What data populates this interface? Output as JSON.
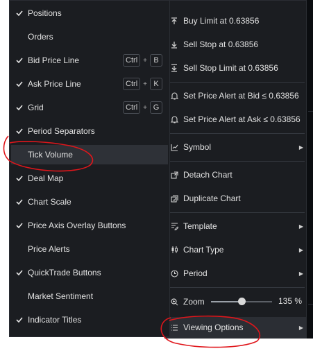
{
  "main_menu": {
    "items": [
      {
        "label": "Buy Limit at 0.63856",
        "icon": "arrow-up-to-line-icon",
        "submenu": false
      },
      {
        "label": "Sell Stop at 0.63856",
        "icon": "arrow-down-to-line-icon",
        "submenu": false
      },
      {
        "label": "Sell Stop Limit at 0.63856",
        "icon": "arrow-down-to-line-double-icon",
        "submenu": false
      },
      {
        "label": "Set Price Alert at Bid ≤ 0.63856",
        "icon": "bell-icon",
        "submenu": false
      },
      {
        "label": "Set Price Alert at Ask ≤ 0.63856",
        "icon": "bell-icon",
        "submenu": false
      },
      {
        "label": "Symbol",
        "icon": "chart-icon",
        "submenu": true
      },
      {
        "label": "Detach Chart",
        "icon": "detach-icon",
        "submenu": false
      },
      {
        "label": "Duplicate Chart",
        "icon": "duplicate-icon",
        "submenu": false
      },
      {
        "label": "Template",
        "icon": "template-icon",
        "submenu": true
      },
      {
        "label": "Chart Type",
        "icon": "candle-icon",
        "submenu": true
      },
      {
        "label": "Period",
        "icon": "clock-icon",
        "submenu": true
      }
    ],
    "zoom": {
      "label": "Zoom",
      "value": "135 %",
      "level": 0.5
    },
    "viewing_options": {
      "label": "Viewing Options",
      "icon": "list-icon",
      "submenu": true
    }
  },
  "sub_menu": {
    "items": [
      {
        "label": "Positions",
        "checked": true
      },
      {
        "label": "Orders",
        "checked": false
      },
      {
        "label": "Bid Price Line",
        "checked": true,
        "shortcut": [
          "Ctrl",
          "B"
        ]
      },
      {
        "label": "Ask Price Line",
        "checked": true,
        "shortcut": [
          "Ctrl",
          "K"
        ]
      },
      {
        "label": "Grid",
        "checked": true,
        "shortcut": [
          "Ctrl",
          "G"
        ]
      },
      {
        "label": "Period Separators",
        "checked": true
      },
      {
        "label": "Tick Volume",
        "checked": false
      },
      {
        "label": "Deal Map",
        "checked": true
      },
      {
        "label": "Chart Scale",
        "checked": true
      },
      {
        "label": "Price Axis Overlay Buttons",
        "checked": true
      },
      {
        "label": "Price Alerts",
        "checked": false
      },
      {
        "label": "QuickTrade Buttons",
        "checked": true
      },
      {
        "label": "Market Sentiment",
        "checked": false
      },
      {
        "label": "Indicator Titles",
        "checked": true
      }
    ],
    "plus_sign": "+"
  },
  "colors": {
    "menu_bg": "#1b1d21",
    "hover_bg": "#2e3137",
    "text": "#e2e2e2",
    "annotation": "#e0161b"
  }
}
